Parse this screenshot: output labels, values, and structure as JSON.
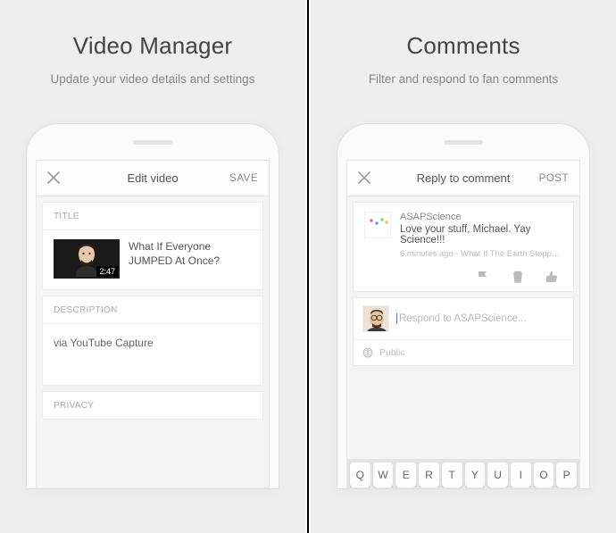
{
  "left": {
    "title": "Video Manager",
    "subtitle": "Update your video details and settings",
    "nav": {
      "title": "Edit video",
      "action": "SAVE"
    },
    "section_title": "TITLE",
    "video_title": "What If Everyone JUMPED At Once?",
    "duration": "2:47",
    "section_desc": "DESCRIPTION",
    "desc_body": "via YouTube Capture",
    "section_privacy": "PRIVACY"
  },
  "right": {
    "title": "Comments",
    "subtitle": "Filter and respond to fan comments",
    "nav": {
      "title": "Reply to comment",
      "action": "POST"
    },
    "comment": {
      "author": "ASAPScience",
      "text": "Love your stuff, Michael. Yay Science!!!",
      "time": "6 minutes ago",
      "sep": " · ",
      "context": "What If The Earth Stopped Spinni..."
    },
    "reply": {
      "placeholder": "Respond to ASAPScience..."
    },
    "privacy_label": "Public",
    "keys": [
      "Q",
      "W",
      "E",
      "R",
      "T",
      "Y",
      "U",
      "I",
      "O",
      "P"
    ]
  }
}
